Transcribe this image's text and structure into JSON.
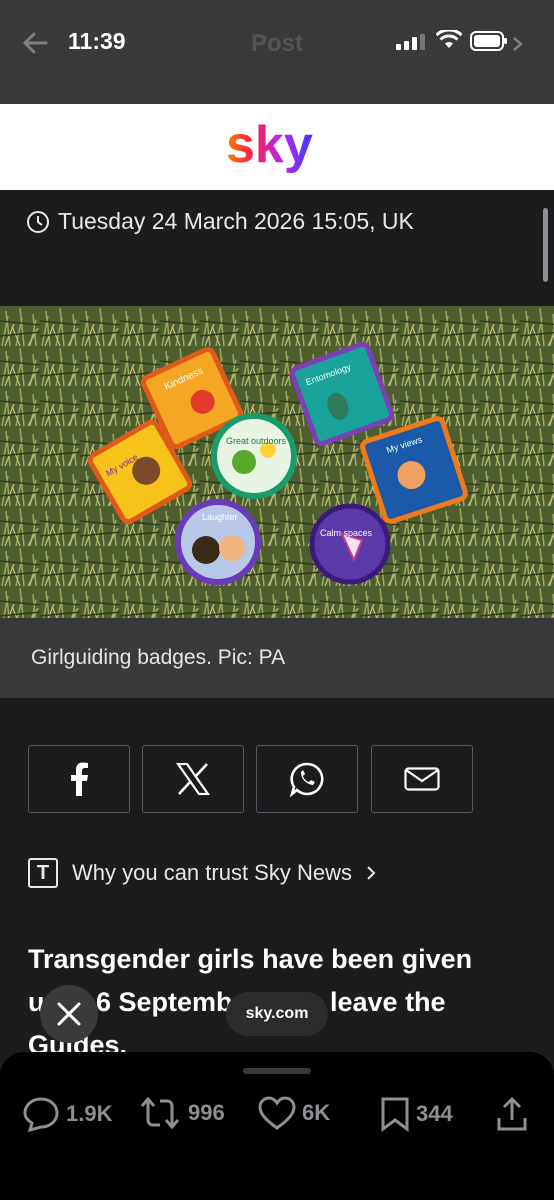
{
  "status_bar": {
    "time": "11:39",
    "title": "Post"
  },
  "header": {
    "brand": "sky"
  },
  "article": {
    "date": "Tuesday 24 March 2026 15:05, UK",
    "caption": "Girlguiding badges. Pic: PA",
    "badges": [
      "Kindness",
      "Entomology",
      "My voice",
      "Great outdoors",
      "My views",
      "Laughter",
      "Calm spaces"
    ],
    "share_buttons": [
      "facebook",
      "x",
      "whatsapp",
      "email"
    ],
    "trust_label": "Why you can trust Sky News",
    "headline_lines": [
      "Transgender girls have been given",
      "u",
      "6 Septemb",
      "leave the",
      "Guides."
    ]
  },
  "overlay": {
    "source": "sky.com"
  },
  "actions": {
    "replies": "1.9K",
    "reposts": "996",
    "likes": "6K",
    "bookmarks": "344"
  },
  "colors": {
    "background": "#1c1c1e",
    "caption_bar": "#3a3a3c",
    "sheet": "#000000",
    "muted": "#8e8e93"
  }
}
